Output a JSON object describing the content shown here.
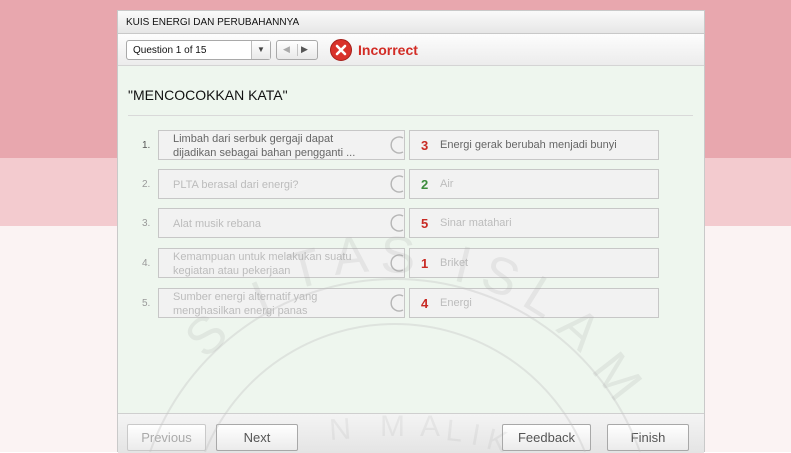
{
  "window": {
    "title": "KUIS ENERGI DAN PERUBAHANNYA"
  },
  "nav": {
    "question_select": "Question 1 of 15",
    "prev_glyph": "◀",
    "next_glyph": "▶",
    "dropdown_glyph": "▼",
    "status_label": "Incorrect",
    "status_color": "#d22c25"
  },
  "question": {
    "title": "\"MENCOCOKKAN KATA\""
  },
  "rows": [
    {
      "num": "1.",
      "left_line1": "Limbah dari serbuk gergaji dapat",
      "left_line2": "dijadikan sebagai bahan pengganti ...",
      "match": "3",
      "match_color": "red",
      "right": "Energi gerak berubah menjadi bunyi"
    },
    {
      "num": "2.",
      "left_line1": "PLTA berasal dari energi?",
      "left_line2": "",
      "match": "2",
      "match_color": "green",
      "right": "Air"
    },
    {
      "num": "3.",
      "left_line1": "Alat musik rebana",
      "left_line2": "",
      "match": "5",
      "match_color": "red",
      "right": "Sinar matahari"
    },
    {
      "num": "4.",
      "left_line1": "Kemampuan untuk melakukan suatu",
      "left_line2": "kegiatan atau pekerjaan",
      "match": "1",
      "match_color": "red",
      "right": "Briket"
    },
    {
      "num": "5.",
      "left_line1": "Sumber energi alternatif yang",
      "left_line2": "menghasilkan energi panas",
      "match": "4",
      "match_color": "red",
      "right": "Energi"
    }
  ],
  "footer": {
    "previous": "Previous",
    "next": "Next",
    "feedback": "Feedback",
    "finish": "Finish"
  }
}
